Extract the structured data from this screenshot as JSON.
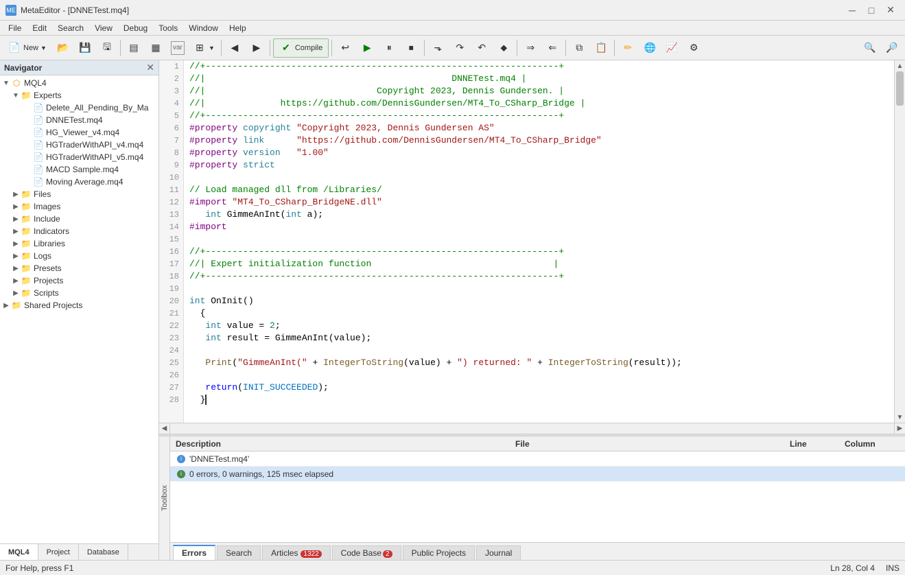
{
  "window": {
    "title": "MetaEditor - [DNNETest.mq4]",
    "icon": "ME"
  },
  "titlebar": {
    "title": "MetaEditor - [DNNETest.mq4]",
    "minimize": "─",
    "maximize": "□",
    "close": "✕"
  },
  "menubar": {
    "items": [
      "File",
      "Edit",
      "Search",
      "View",
      "Debug",
      "Tools",
      "Window",
      "Help"
    ]
  },
  "toolbar": {
    "new_label": "New",
    "compile_label": "Compile"
  },
  "navigator": {
    "title": "Navigator",
    "tree": [
      {
        "label": "MQL4",
        "type": "root",
        "level": 0,
        "expanded": true
      },
      {
        "label": "Experts",
        "type": "folder",
        "level": 1,
        "expanded": true
      },
      {
        "label": "Delete_All_Pending_By_Ma",
        "type": "file",
        "level": 2
      },
      {
        "label": "DNNETest.mq4",
        "type": "file",
        "level": 2
      },
      {
        "label": "HG_Viewer_v4.mq4",
        "type": "file",
        "level": 2
      },
      {
        "label": "HGTraderWithAPI_v4.mq4",
        "type": "file",
        "level": 2
      },
      {
        "label": "HGTraderWithAPI_v5.mq4",
        "type": "file",
        "level": 2
      },
      {
        "label": "MACD Sample.mq4",
        "type": "file",
        "level": 2
      },
      {
        "label": "Moving Average.mq4",
        "type": "file",
        "level": 2
      },
      {
        "label": "Files",
        "type": "folder",
        "level": 1,
        "expanded": false
      },
      {
        "label": "Images",
        "type": "folder",
        "level": 1,
        "expanded": false
      },
      {
        "label": "Include",
        "type": "folder",
        "level": 1,
        "expanded": false
      },
      {
        "label": "Indicators",
        "type": "folder",
        "level": 1,
        "expanded": false
      },
      {
        "label": "Libraries",
        "type": "folder",
        "level": 1,
        "expanded": false
      },
      {
        "label": "Logs",
        "type": "folder",
        "level": 1,
        "expanded": false
      },
      {
        "label": "Presets",
        "type": "folder",
        "level": 1,
        "expanded": false
      },
      {
        "label": "Projects",
        "type": "folder",
        "level": 1,
        "expanded": false
      },
      {
        "label": "Scripts",
        "type": "folder",
        "level": 1,
        "expanded": false
      },
      {
        "label": "Shared Projects",
        "type": "shared-folder",
        "level": 0
      }
    ],
    "tabs": [
      "MQL4",
      "Project",
      "Database"
    ]
  },
  "code": {
    "lines": [
      {
        "n": 1,
        "text": "//+------------------------------------------------------------------+"
      },
      {
        "n": 2,
        "text": "//|                                              DNNETest.mq4 |"
      },
      {
        "n": 3,
        "text": "//|                                Copyright 2023, Dennis Gundersen. |"
      },
      {
        "n": 4,
        "text": "//|              https://github.com/DennisGundersen/MT4_To_CSharp_Bridge |"
      },
      {
        "n": 5,
        "text": "//+------------------------------------------------------------------+"
      },
      {
        "n": 6,
        "text": "#property copyright \"Copyright 2023, Dennis Gundersen AS\""
      },
      {
        "n": 7,
        "text": "#property link      \"https://github.com/DennisGundersen/MT4_To_CSharp_Bridge\""
      },
      {
        "n": 8,
        "text": "#property version   \"1.00\""
      },
      {
        "n": 9,
        "text": "#property strict"
      },
      {
        "n": 10,
        "text": ""
      },
      {
        "n": 11,
        "text": "// Load managed dll from /Libraries/"
      },
      {
        "n": 12,
        "text": "#import \"MT4_To_CSharp_BridgeNE.dll\""
      },
      {
        "n": 13,
        "text": "   int GimmeAnInt(int a);"
      },
      {
        "n": 14,
        "text": "#import"
      },
      {
        "n": 15,
        "text": ""
      },
      {
        "n": 16,
        "text": "//+------------------------------------------------------------------+"
      },
      {
        "n": 17,
        "text": "//| Expert initialization function                                  |"
      },
      {
        "n": 18,
        "text": "//+------------------------------------------------------------------+"
      },
      {
        "n": 19,
        "text": ""
      },
      {
        "n": 20,
        "text": "int OnInit()"
      },
      {
        "n": 21,
        "text": "  {"
      },
      {
        "n": 22,
        "text": "   int value = 2;"
      },
      {
        "n": 23,
        "text": "   int result = GimmeAnInt(value);"
      },
      {
        "n": 24,
        "text": ""
      },
      {
        "n": 25,
        "text": "   Print(\"GimmeAnInt(\" + IntegerToString(value) + \") returned: \" + IntegerToString(result));"
      },
      {
        "n": 26,
        "text": ""
      },
      {
        "n": 27,
        "text": "   return(INIT_SUCCEEDED);"
      },
      {
        "n": 28,
        "text": "  }"
      }
    ]
  },
  "output": {
    "columns": {
      "description": "Description",
      "file": "File",
      "line": "Line",
      "column": "Column"
    },
    "rows": [
      {
        "desc": "'DNNETest.mq4'",
        "file": "",
        "line": "",
        "col": "",
        "icon": "circle"
      },
      {
        "desc": "0 errors, 0 warnings, 125 msec elapsed",
        "file": "",
        "line": "",
        "col": "",
        "icon": "circle"
      }
    ]
  },
  "bottom_tabs": [
    {
      "label": "Errors",
      "active": true,
      "badge": null
    },
    {
      "label": "Search",
      "active": false,
      "badge": null
    },
    {
      "label": "Articles",
      "active": false,
      "badge": "1322"
    },
    {
      "label": "Code Base",
      "active": false,
      "badge": "2"
    },
    {
      "label": "Public Projects",
      "active": false,
      "badge": null
    },
    {
      "label": "Journal",
      "active": false,
      "badge": null
    }
  ],
  "statusbar": {
    "left": "For Help, press F1",
    "position": "Ln 28, Col 4",
    "mode": "INS"
  },
  "toolbox": {
    "label": "Toolbox"
  }
}
